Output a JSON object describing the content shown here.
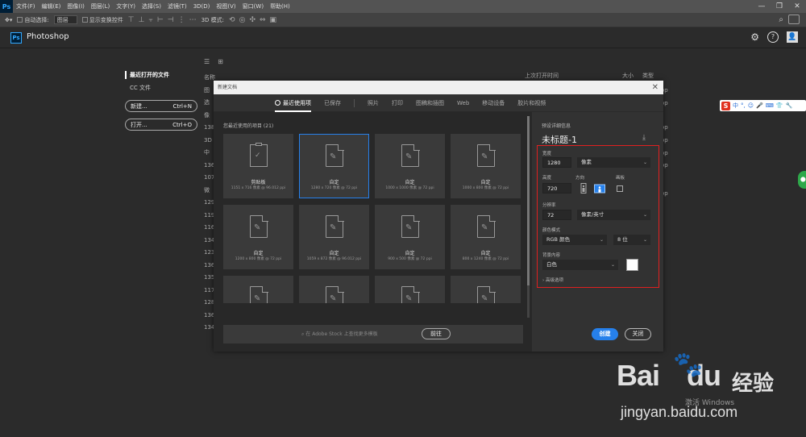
{
  "menubar": {
    "logo": "Ps",
    "items": [
      "文件(F)",
      "编辑(E)",
      "图像(I)",
      "图层(L)",
      "文字(Y)",
      "选择(S)",
      "滤镜(T)",
      "3D(D)",
      "视图(V)",
      "窗口(W)",
      "帮助(H)"
    ],
    "win_buttons": [
      "—",
      "❐",
      "✕"
    ]
  },
  "optbar": {
    "auto_select": "自动选择:",
    "layer_select": "图层",
    "show_transform": "显示变换控件",
    "mode_3d": "3D 模式:"
  },
  "home": {
    "title": "Photoshop",
    "logo": "Ps",
    "nav_recent": "最近打开的文件",
    "nav_cc": "CC 文件",
    "new_label": "新建...",
    "new_shortcut": "Ctrl+N",
    "open_label": "打开...",
    "open_shortcut": "Ctrl+O",
    "col_name": "名称",
    "col_opened": "上次打开时间",
    "col_size": "大小",
    "col_type": "类型",
    "list_rows": [
      "图",
      "选",
      "像",
      "138",
      "3D",
      "中",
      "136",
      "107",
      "微",
      "129",
      "119",
      "116",
      "134",
      "123",
      "136",
      "135",
      "117",
      "128",
      "136",
      "134"
    ],
    "peek_rows": [
      "op",
      "op",
      "op",
      "op",
      "op",
      "op",
      "op"
    ]
  },
  "dialog": {
    "title": "新建文档",
    "tabs": [
      "最近使用项",
      "已保存",
      "照片",
      "打印",
      "图稿和插图",
      "Web",
      "移动设备",
      "胶片和视频"
    ],
    "recent_label": "您最近使用的项目 (21)",
    "cards": [
      {
        "name": "剪贴板",
        "dim": "1151 x 716 像素 @ 96.012 ppi"
      },
      {
        "name": "自定",
        "dim": "1280 x 720 像素 @ 72 ppi"
      },
      {
        "name": "自定",
        "dim": "1000 x 1000 像素 @ 72 ppi"
      },
      {
        "name": "自定",
        "dim": "1000 x 800 像素 @ 72 ppi"
      },
      {
        "name": "自定",
        "dim": "1200 x 800 像素 @ 72 ppi"
      },
      {
        "name": "自定",
        "dim": "1059 x 872 像素 @ 96.012 ppi"
      },
      {
        "name": "自定",
        "dim": "900 x 500 像素 @ 72 ppi"
      },
      {
        "name": "自定",
        "dim": "800 x 1240 像素 @ 72 ppi"
      },
      {
        "name": "",
        "dim": ""
      },
      {
        "name": "",
        "dim": ""
      },
      {
        "name": "",
        "dim": ""
      },
      {
        "name": "",
        "dim": ""
      }
    ],
    "stock_placeholder": "在 Adobe Stock 上查找更多模板",
    "go_label": "前往",
    "preset_label": "预设详细信息",
    "doc_name": "未标题-1",
    "width_label": "宽度",
    "width_value": "1280",
    "width_unit": "像素",
    "height_label": "高度",
    "height_value": "720",
    "orientation_label": "方向",
    "artboard_label": "画板",
    "resolution_label": "分辨率",
    "resolution_value": "72",
    "resolution_unit": "像素/英寸",
    "color_mode_label": "颜色模式",
    "color_mode_value": "RGB 颜色",
    "bit_depth": "8 位",
    "bg_label": "背景内容",
    "bg_value": "白色",
    "bg_color": "#ffffff",
    "advanced_label": "高级选项",
    "create_label": "创建",
    "close_label": "关闭"
  },
  "ime": {
    "logo": "S",
    "items": [
      "中",
      "°,",
      "☺",
      "🎤",
      "⌨",
      "👕",
      "🔧"
    ]
  },
  "watermark": {
    "brand": "Bai",
    "brand_tail": "du",
    "site_cn": "经验",
    "windows": "激活 Windows",
    "url": "jingyan.baidu.com"
  },
  "colors": {
    "accent": "#2680eb",
    "highlight_box": "#e02020"
  }
}
